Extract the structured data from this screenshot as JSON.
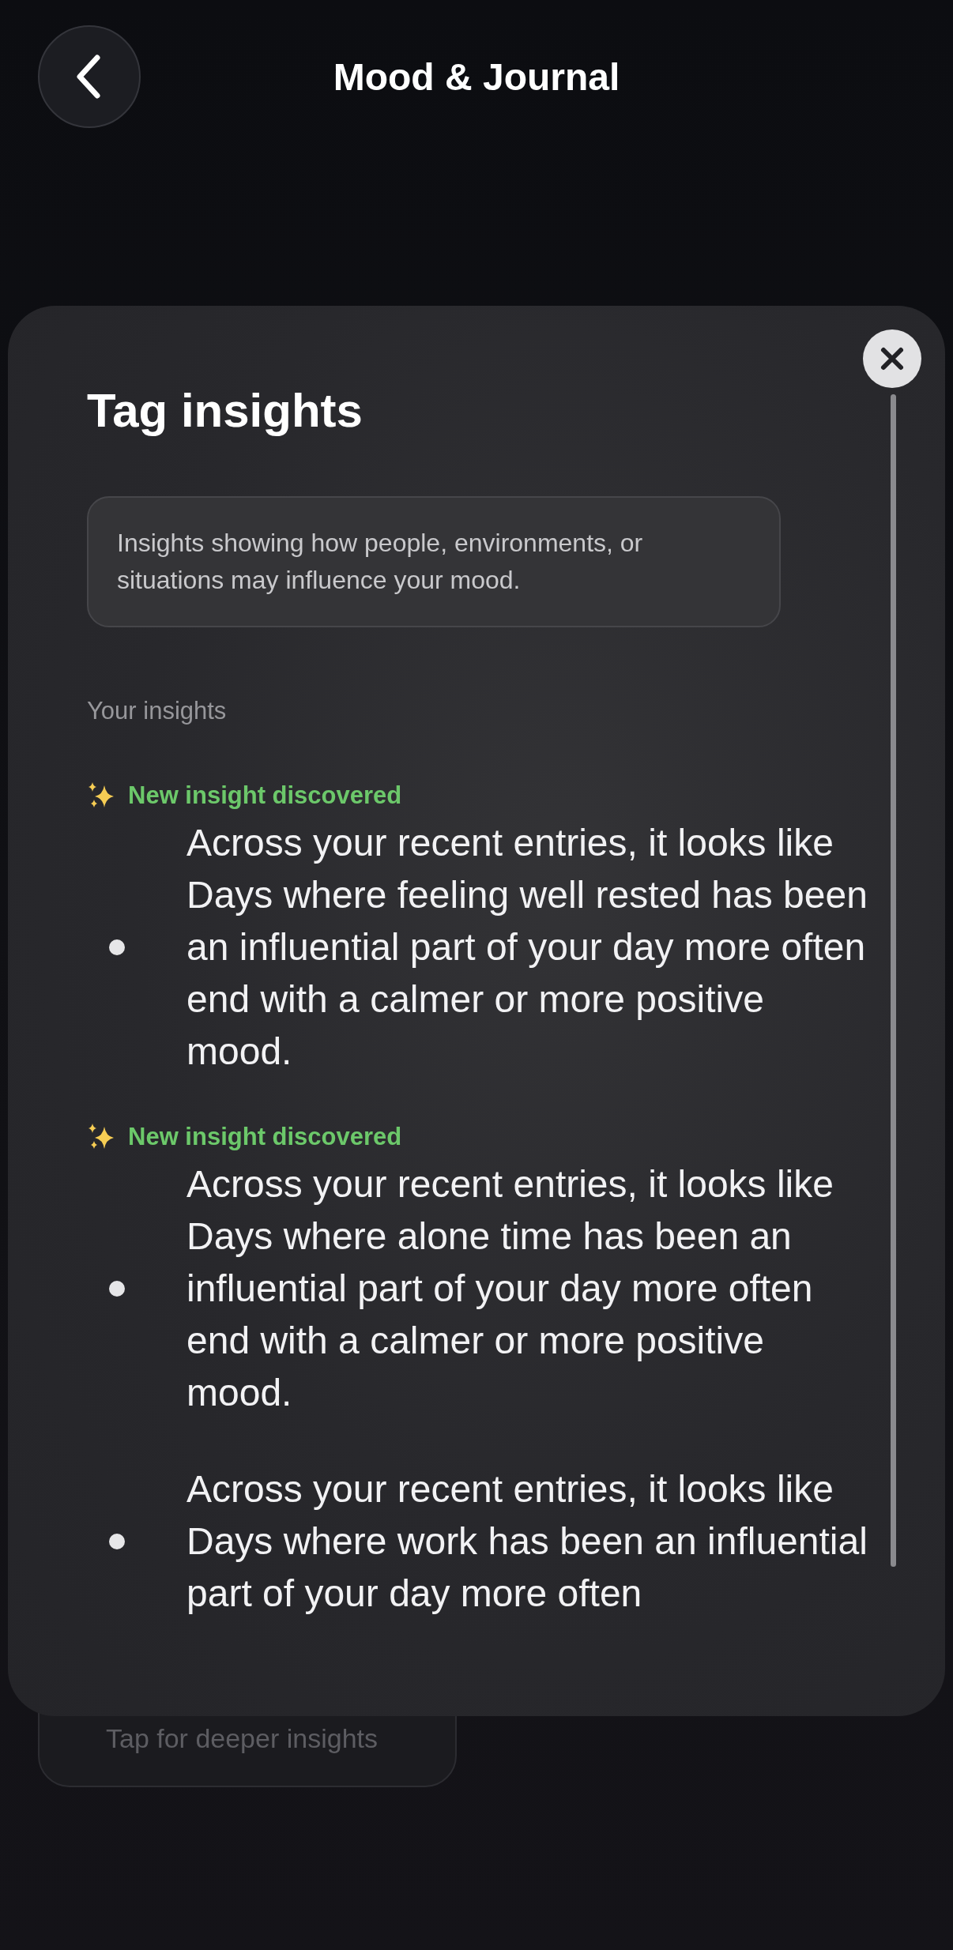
{
  "header": {
    "title": "Mood & Journal"
  },
  "background": {
    "card_hint": "Tap for deeper insights"
  },
  "sheet": {
    "title": "Tag insights",
    "description": "Insights showing how people, environments, or situations may influence your mood.",
    "section_label": "Your insights",
    "insights": [
      {
        "label": "New insight discovered",
        "text": "Across your recent entries, it looks like Days where feeling well rested has been an influential part of your day more often end with a calmer or more positive mood."
      },
      {
        "label": "New insight discovered",
        "text": "Across your recent entries, it looks like Days where alone time has been an influential part of your day more often end with a calmer or more positive mood."
      },
      {
        "text": "Across your recent entries, it looks like Days where work has been an influential part of your day more often"
      }
    ]
  }
}
